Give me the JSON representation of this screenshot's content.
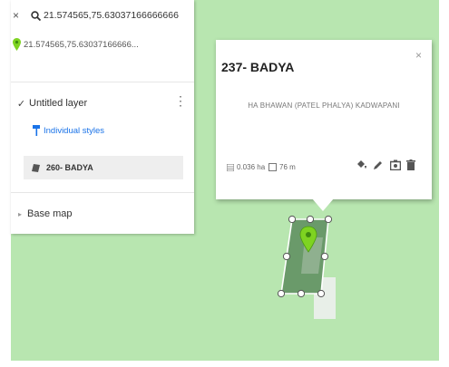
{
  "search": {
    "query": "21.574565,75.63037166666666",
    "result": "21.574565,75.63037166666..."
  },
  "layers_panel": {
    "layer_name": "Untitled layer",
    "styles_link": "Individual styles",
    "feature_label": "260- BADYA",
    "base_map_label": "Base map"
  },
  "popup": {
    "title": "237- BADYA",
    "description": "HA BHAWAN (PATEL PHALYA) KADWAPANI",
    "area": "0.036 ha",
    "perimeter": "76 m"
  },
  "colors": {
    "map_green": "#b8e6b0",
    "parcel_fill": "#6a9a6a",
    "pin_green": "#7ed321",
    "link_blue": "#1a73e8"
  }
}
